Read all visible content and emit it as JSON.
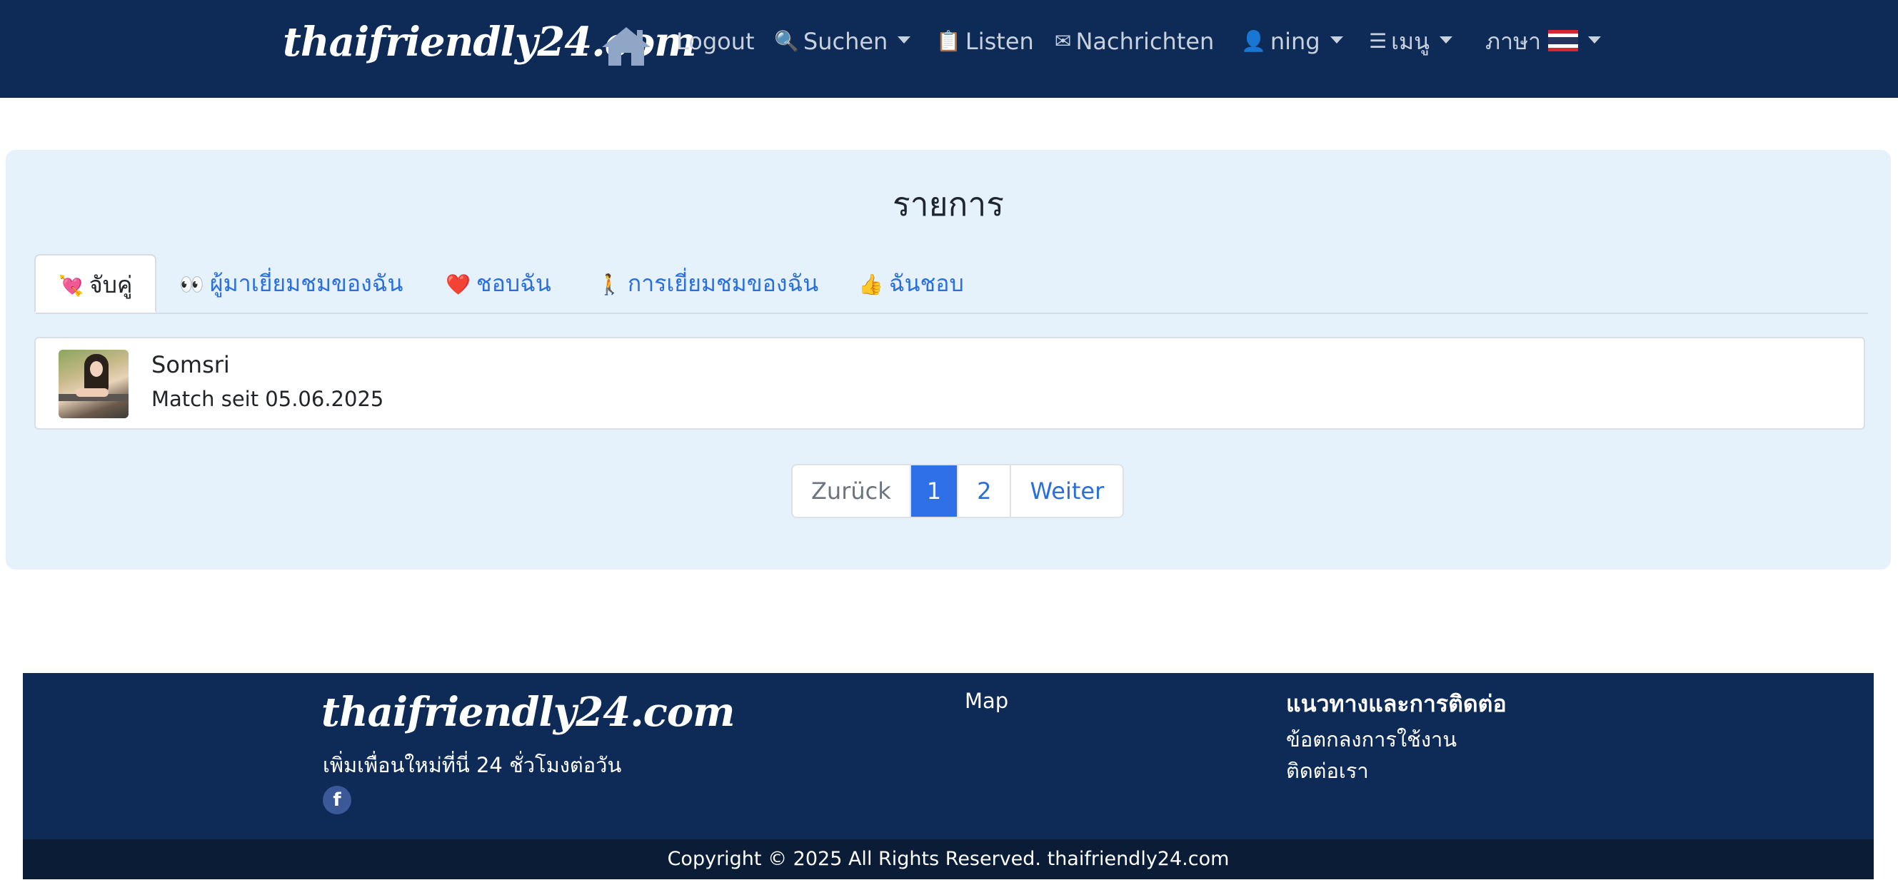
{
  "nav": {
    "brand": "thaifriendly24.com",
    "items": [
      {
        "label": "Logout"
      },
      {
        "label": "Suchen",
        "icon": "magnifier-icon",
        "glyph": "🔍"
      },
      {
        "label": "Listen",
        "icon": "clipboard-icon",
        "glyph": "📋"
      },
      {
        "label": "Nachrichten",
        "icon": "envelope-icon",
        "glyph": "✉"
      },
      {
        "label": "ning",
        "icon": "user-icon",
        "glyph": "👤"
      },
      {
        "label": "เมนู",
        "icon": "menu-icon",
        "glyph": "☰"
      },
      {
        "label": "ภาษา",
        "icon": "thai-flag-icon"
      }
    ]
  },
  "panel": {
    "title": "รายการ",
    "tabs": [
      {
        "label": "จับคู่",
        "glyph": "💘",
        "icon": "heart-arrow-icon",
        "active": true
      },
      {
        "label": "ผู้มาเยี่ยมชมของฉัน",
        "glyph": "👀",
        "icon": "eyes-icon"
      },
      {
        "label": "ชอบฉัน",
        "glyph": "❤️",
        "icon": "heart-icon"
      },
      {
        "label": "การเยี่ยมชมของฉัน",
        "glyph": "🚶",
        "icon": "walking-icon"
      },
      {
        "label": "ฉันชอบ",
        "glyph": "👍",
        "icon": "thumbs-up-icon"
      }
    ],
    "matches": [
      {
        "name": "Somsri",
        "since": "Match seit 05.06.2025"
      }
    ]
  },
  "pagination": {
    "prev": "Zurück",
    "pages": [
      "1",
      "2"
    ],
    "current_page": "1",
    "next": "Weiter"
  },
  "footer": {
    "brand": "thaifriendly24.com",
    "tagline": "เพิ่มเพื่อนใหม่ที่นี่ 24 ชั่วโมงต่อวัน",
    "facebook": "f",
    "map_link": "Map",
    "guide_heading": "แนวทางและการติดต่อ",
    "terms_link": "ข้อตกลงการใช้งาน",
    "contact_link": "ติดต่อเรา",
    "copyright": "Copyright © 2025 All Rights Reserved. thaifriendly24.com"
  },
  "colors": {
    "navbar": "#0e2a57",
    "panel": "#e5f1fb",
    "link": "#2a6fdb",
    "active_page": "#2f6fe8"
  }
}
